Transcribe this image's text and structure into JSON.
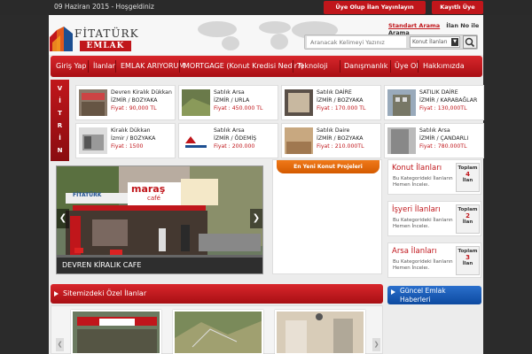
{
  "topbar": {
    "date": "09 Haziran 2015 - Hoşgeldiniz",
    "register_btn": "Üye Olup İlan Yayınlayın",
    "login_btn": "Kayıtlı Üye Girişi"
  },
  "header": {
    "logo_line1": "FİTATÜRK",
    "logo_line2": "EMLAK",
    "tab_standard": "Standart Arama",
    "tab_id": "İlan No ile Arama",
    "search_placeholder": "Aranacak Kelimeyi Yazınız",
    "search_select": "Konut İlanları"
  },
  "nav": [
    "Giriş Yap",
    "İlanlar",
    "EMLAK ARIYORUM",
    "MORTGAGE (Konut Kredisi Nedir?)",
    "Teknoloji",
    "Danışmanlık",
    "Üye Ol",
    "Hakkımızda"
  ],
  "vitrin": {
    "label": [
      "V",
      "İ",
      "T",
      "R",
      "İ",
      "N"
    ],
    "items": [
      {
        "title": "Devren Kiralık Dükkan",
        "loc": "İZMİR / BOZYAKA",
        "price": "Fiyat : 90,000 TL"
      },
      {
        "title": "Satılık Arsa",
        "loc": "İZMİR / URLA",
        "price": "Fiyat : 450.000 TL"
      },
      {
        "title": "Satılık DAİRE",
        "loc": "İZMİR / BOZYAKA",
        "price": "Fiyat : 170.000 TL"
      },
      {
        "title": "SATILIK DAİRE",
        "loc": "İZMİR / KARABAĞLAR",
        "price": "Fiyat : 130,000TL"
      },
      {
        "title": "Kiralık Dükkan",
        "loc": "İzmir / BOZYAKA",
        "price": "Fiyat : 1500"
      },
      {
        "title": "Satılık Arsa",
        "loc": "İZMİR / ÖDEMİŞ",
        "price": "Fiyat : 200.000"
      },
      {
        "title": "Satılık Daire",
        "loc": "İZMİR / BOZYAKA",
        "price": "Fiyat : 210.000TL"
      },
      {
        "title": "Satılık Arsa",
        "loc": "İZMİR / ÇANDARLI",
        "price": "Fiyat : 780.000TL"
      }
    ]
  },
  "slider": {
    "caption": "DEVREN KİRALIK CAFE",
    "sign_brand": "maraş",
    "sign_sub": "café",
    "sign_side": "FİTATÜRK"
  },
  "projects": {
    "title": "En Yeni Konut Projeleri"
  },
  "categories": [
    {
      "title": "Konut İlanları",
      "d1": "Bu Kategorideki İlanların",
      "d2": "Hemen İnceleı.",
      "a": "Toplam",
      "b": "4",
      "c": "İlan"
    },
    {
      "title": "İşyeri İlanları",
      "d1": "Bu Kategorideki İlanların",
      "d2": "Hemen İnceleı.",
      "a": "Toplam",
      "b": "2",
      "c": "İlan"
    },
    {
      "title": "Arsa İlanları",
      "d1": "Bu Kategorideki İlanların",
      "d2": "Hemen İnceleı.",
      "a": "Toplam",
      "b": "3",
      "c": "İlan"
    }
  ],
  "special": {
    "title": "Sitemizdeki Özel İlanlar"
  },
  "news": {
    "line1": "Güncel Emlak",
    "line2": "Haberleri"
  },
  "colors": {
    "brand_red": "#c0161b",
    "accent_orange": "#f07a1a",
    "news_blue": "#1a5cb8"
  }
}
